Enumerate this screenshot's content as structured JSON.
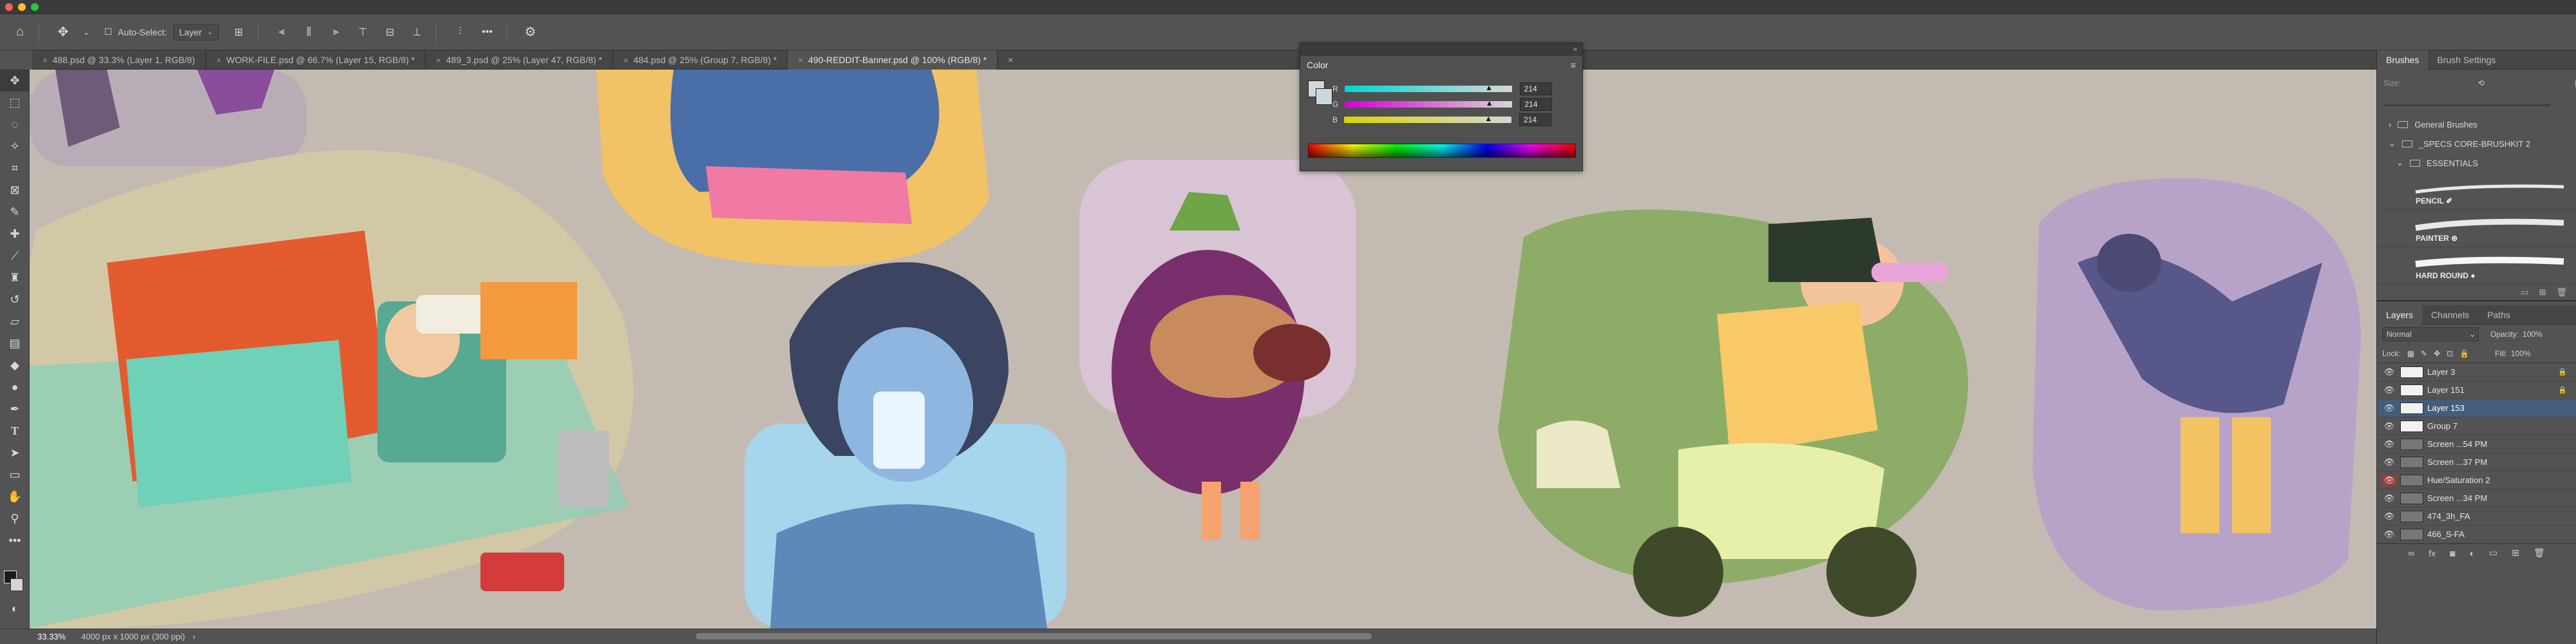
{
  "titlebar": {
    "traffic_colors": [
      "#fe5f57",
      "#febc2e",
      "#28c840"
    ]
  },
  "options_bar": {
    "home_icon": "home-icon",
    "move_icon": "move-icon",
    "auto_select_label": "Auto-Select:",
    "auto_select_value": "Layer",
    "more_label": "•••",
    "settings_icon": "gear-icon"
  },
  "tabs": [
    {
      "label": "488.psd @ 33.3% (Layer 1, RGB/8)",
      "active": false
    },
    {
      "label": "WORK-FILE.psd @ 66.7% (Layer 15, RGB/8) *",
      "active": false
    },
    {
      "label": "489_3.psd @ 25% (Layer 47, RGB/8) *",
      "active": false
    },
    {
      "label": "484.psd @ 25% (Group 7, RGB/8) *",
      "active": false
    },
    {
      "label": "490-REDDIT-Banner.psd @ 100% (RGB/8) *",
      "active": true
    }
  ],
  "tools": [
    "move-icon",
    "marquee-icon",
    "lasso-icon",
    "magic-wand-icon",
    "crop-icon",
    "frame-icon",
    "eyedropper-icon",
    "healing-brush-icon",
    "brush-icon",
    "clone-stamp-icon",
    "history-brush-icon",
    "eraser-icon",
    "gradient-icon",
    "blur-icon",
    "dodge-icon",
    "pen-icon",
    "type-icon",
    "path-select-icon",
    "rectangle-icon",
    "hand-icon",
    "zoom-icon",
    "more-tools-icon"
  ],
  "color_panel": {
    "title": "Color",
    "r_label": "R",
    "g_label": "G",
    "b_label": "B",
    "r": "214",
    "g": "214",
    "b": "214",
    "r_frac": 0.84,
    "g_frac": 0.84,
    "b_frac": 0.84
  },
  "brushes_panel": {
    "tabs": [
      "Brushes",
      "Brush Settings"
    ],
    "size_label": "Size:",
    "folders": [
      "General Brushes",
      "_SPECS CORE-BRUSHKIT 2",
      "ESSENTIALS"
    ],
    "strokes": [
      "PENCIL ✐",
      "PAINTER ⊕",
      "HARD ROUND ●"
    ]
  },
  "layers_panel": {
    "tabs": [
      "Layers",
      "Channels",
      "Paths"
    ],
    "blend_mode": "Normal",
    "opacity_label": "Opacity:",
    "opacity_value": "100%",
    "lock_label": "Lock:",
    "fill_label": "Fill:",
    "fill_value": "100%",
    "layers": [
      {
        "name": "Layer 3",
        "locked": true,
        "selected": false
      },
      {
        "name": "Layer 151",
        "locked": true,
        "selected": false
      },
      {
        "name": "Layer 153",
        "locked": false,
        "selected": true
      },
      {
        "name": "Group 7",
        "locked": false,
        "selected": false
      },
      {
        "name": "Screen ...54 PM",
        "locked": false,
        "selected": false
      },
      {
        "name": "Screen ...37 PM",
        "locked": false,
        "selected": false
      },
      {
        "name": "Hue/Saturation 2",
        "locked": false,
        "selected": false
      },
      {
        "name": "Screen ...34 PM",
        "locked": false,
        "selected": false
      },
      {
        "name": "474_3h_FA",
        "locked": false,
        "selected": false
      },
      {
        "name": "466_S-FA",
        "locked": false,
        "selected": false
      }
    ]
  },
  "status_bar": {
    "zoom": "33.33%",
    "doc_info": "4000 px x 1000 px (300 ppi)",
    "arrow": "›"
  }
}
